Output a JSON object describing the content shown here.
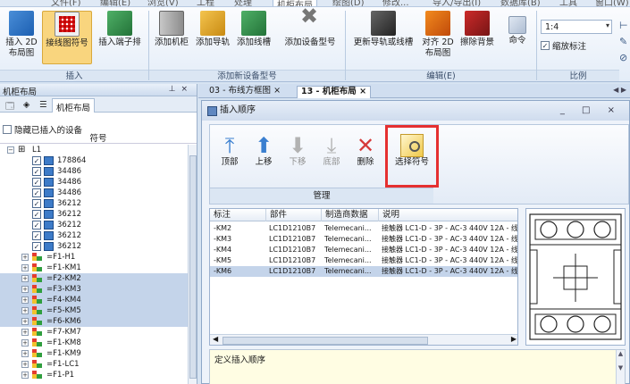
{
  "menu": {
    "items": [
      "文件(F)",
      "编辑(E)",
      "浏览(V)",
      "工程",
      "处理",
      "机柜布局",
      "绘图(D)",
      "修改...",
      "导入/导出(I)",
      "数据库(B)",
      "工具",
      "窗口(W)"
    ],
    "active": "机柜布局"
  },
  "ribbon": {
    "buttons": {
      "insert2d": "插入 2D\n布局图",
      "wiring": "接线图符号",
      "terminal": "插入端子排",
      "cabinet": "添加机柜",
      "rail": "添加导轨",
      "duct": "添加线槽",
      "devtype": "添加设备型号",
      "update": "更新导轨或线槽",
      "align": "对齐 2D\n布局图",
      "erase": "擦除背景",
      "command": "命令"
    },
    "groups": {
      "insert": "插入",
      "add_device": "添加新设备型号",
      "edit": "编辑(E)",
      "scale": "比例"
    },
    "scale_value": "1:4",
    "scale_checkbox": "缩放标注"
  },
  "left_panel": {
    "title": "机柜布局",
    "tab_label": "机柜布局",
    "hidden_label": "隐藏已插入的设备",
    "column_header": "符号",
    "root": "L1",
    "checked_items": [
      "178864",
      "34486",
      "34486",
      "34486",
      "36212",
      "36212",
      "36212",
      "36212",
      "36212"
    ],
    "groups": [
      {
        "label": "=F1-H1",
        "highlighted": false
      },
      {
        "label": "=F1-KM1",
        "highlighted": false
      },
      {
        "label": "=F2-KM2",
        "highlighted": true
      },
      {
        "label": "=F3-KM3",
        "highlighted": true
      },
      {
        "label": "=F4-KM4",
        "highlighted": true
      },
      {
        "label": "=F5-KM5",
        "highlighted": true
      },
      {
        "label": "=F6-KM6",
        "highlighted": true
      },
      {
        "label": "=F7-KM7",
        "highlighted": false
      },
      {
        "label": "=F1-KM8",
        "highlighted": false
      },
      {
        "label": "=F1-KM9",
        "highlighted": false
      },
      {
        "label": "=F1-LC1",
        "highlighted": false
      },
      {
        "label": "=F1-P1",
        "highlighted": false
      }
    ]
  },
  "doc_tabs": [
    "03 - 布线方框图",
    "13 - 机柜布局"
  ],
  "dialog": {
    "title": "插入顺序",
    "buttons": {
      "top": "顶部",
      "up": "上移",
      "down": "下移",
      "bottom": "底部",
      "delete": "删除",
      "pick": "选择符号"
    },
    "group_label": "管理",
    "columns": [
      "标注",
      "部件",
      "制造商数据",
      "说明"
    ],
    "rows": [
      {
        "tag": "-KM2",
        "part": "LC1D1210B7",
        "mfr": "Telemecani...",
        "desc": "接触器 LC1-D - 3P - AC-3 440V 12A - 线圈",
        "selected": false
      },
      {
        "tag": "-KM3",
        "part": "LC1D1210B7",
        "mfr": "Telemecani...",
        "desc": "接触器 LC1-D - 3P - AC-3 440V 12A - 线圈",
        "selected": false
      },
      {
        "tag": "-KM4",
        "part": "LC1D1210B7",
        "mfr": "Telemecani...",
        "desc": "接触器 LC1-D - 3P - AC-3 440V 12A - 线圈",
        "selected": false
      },
      {
        "tag": "-KM5",
        "part": "LC1D1210B7",
        "mfr": "Telemecani...",
        "desc": "接触器 LC1-D - 3P - AC-3 440V 12A - 线圈",
        "selected": false
      },
      {
        "tag": "-KM6",
        "part": "LC1D1210B7",
        "mfr": "Telemecani...",
        "desc": "接触器 LC1-D - 3P - AC-3 440V 12A - 线圈",
        "selected": true
      }
    ],
    "description": "定义插入顺序"
  }
}
